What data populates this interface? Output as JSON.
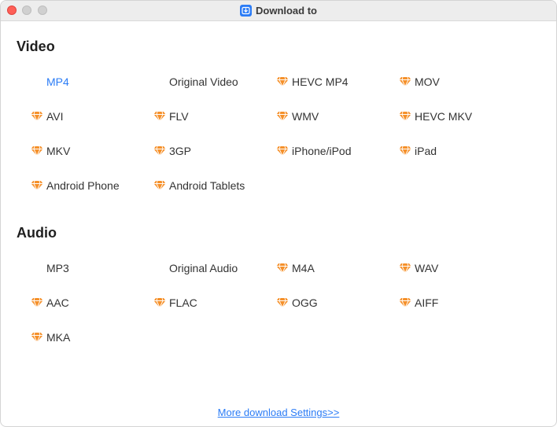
{
  "window": {
    "title": "Download to"
  },
  "video": {
    "heading": "Video",
    "formats": [
      {
        "label": "MP4",
        "premium": false,
        "selected": true
      },
      {
        "label": "Original Video",
        "premium": false,
        "selected": false
      },
      {
        "label": "HEVC MP4",
        "premium": true,
        "selected": false
      },
      {
        "label": "MOV",
        "premium": true,
        "selected": false
      },
      {
        "label": "AVI",
        "premium": true,
        "selected": false
      },
      {
        "label": "FLV",
        "premium": true,
        "selected": false
      },
      {
        "label": "WMV",
        "premium": true,
        "selected": false
      },
      {
        "label": "HEVC MKV",
        "premium": true,
        "selected": false
      },
      {
        "label": "MKV",
        "premium": true,
        "selected": false
      },
      {
        "label": "3GP",
        "premium": true,
        "selected": false
      },
      {
        "label": "iPhone/iPod",
        "premium": true,
        "selected": false
      },
      {
        "label": "iPad",
        "premium": true,
        "selected": false
      },
      {
        "label": "Android Phone",
        "premium": true,
        "selected": false
      },
      {
        "label": "Android Tablets",
        "premium": true,
        "selected": false
      }
    ]
  },
  "audio": {
    "heading": "Audio",
    "formats": [
      {
        "label": "MP3",
        "premium": false,
        "selected": false
      },
      {
        "label": "Original Audio",
        "premium": false,
        "selected": false
      },
      {
        "label": "M4A",
        "premium": true,
        "selected": false
      },
      {
        "label": "WAV",
        "premium": true,
        "selected": false
      },
      {
        "label": "AAC",
        "premium": true,
        "selected": false
      },
      {
        "label": "FLAC",
        "premium": true,
        "selected": false
      },
      {
        "label": "OGG",
        "premium": true,
        "selected": false
      },
      {
        "label": "AIFF",
        "premium": true,
        "selected": false
      },
      {
        "label": "MKA",
        "premium": true,
        "selected": false
      }
    ]
  },
  "footer": {
    "settings_link": "More download Settings>>"
  },
  "colors": {
    "accent": "#2b7cf6",
    "premium_gem": "#f5902a"
  }
}
